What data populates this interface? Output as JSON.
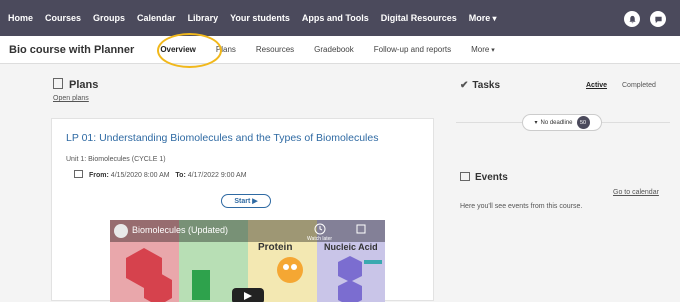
{
  "topnav": {
    "items": [
      "Home",
      "Courses",
      "Groups",
      "Calendar",
      "Library",
      "Your students",
      "Apps and Tools",
      "Digital Resources",
      "More"
    ],
    "icons": [
      "bell-icon",
      "chat-icon"
    ]
  },
  "subnav": {
    "course_title": "Bio course with Planner",
    "tabs": [
      "Overview",
      "Plans",
      "Resources",
      "Gradebook",
      "Follow-up and reports",
      "More"
    ],
    "active_tab": "Overview"
  },
  "plans": {
    "title": "Plans",
    "open_link": "Open plans",
    "card": {
      "title": "LP 01: Understanding Biomolecules and the Types of Biomolecules",
      "unit": "Unit 1: Biomolecules (CYCLE 1)",
      "from_label": "From:",
      "from_value": "4/15/2020 8:00 AM",
      "to_label": "To:",
      "to_value": "4/17/2022 9:00 AM",
      "start_label": "Start ▶",
      "video": {
        "title": "Biomolecules (Updated)",
        "watch_later": "Watch later",
        "panels": [
          "",
          "",
          "Protein",
          "Nucleic Acid"
        ]
      }
    }
  },
  "tasks": {
    "title": "Tasks",
    "active_label": "Active",
    "completed_label": "Completed",
    "filter_label": "No deadline",
    "count": "50"
  },
  "events": {
    "title": "Events",
    "calendar_link": "Go to calendar",
    "empty_text": "Here you'll see events from this course."
  },
  "colors": {
    "topnav": "#4b4a5c",
    "link": "#2f6aa3",
    "highlight": "#f1b81b"
  }
}
